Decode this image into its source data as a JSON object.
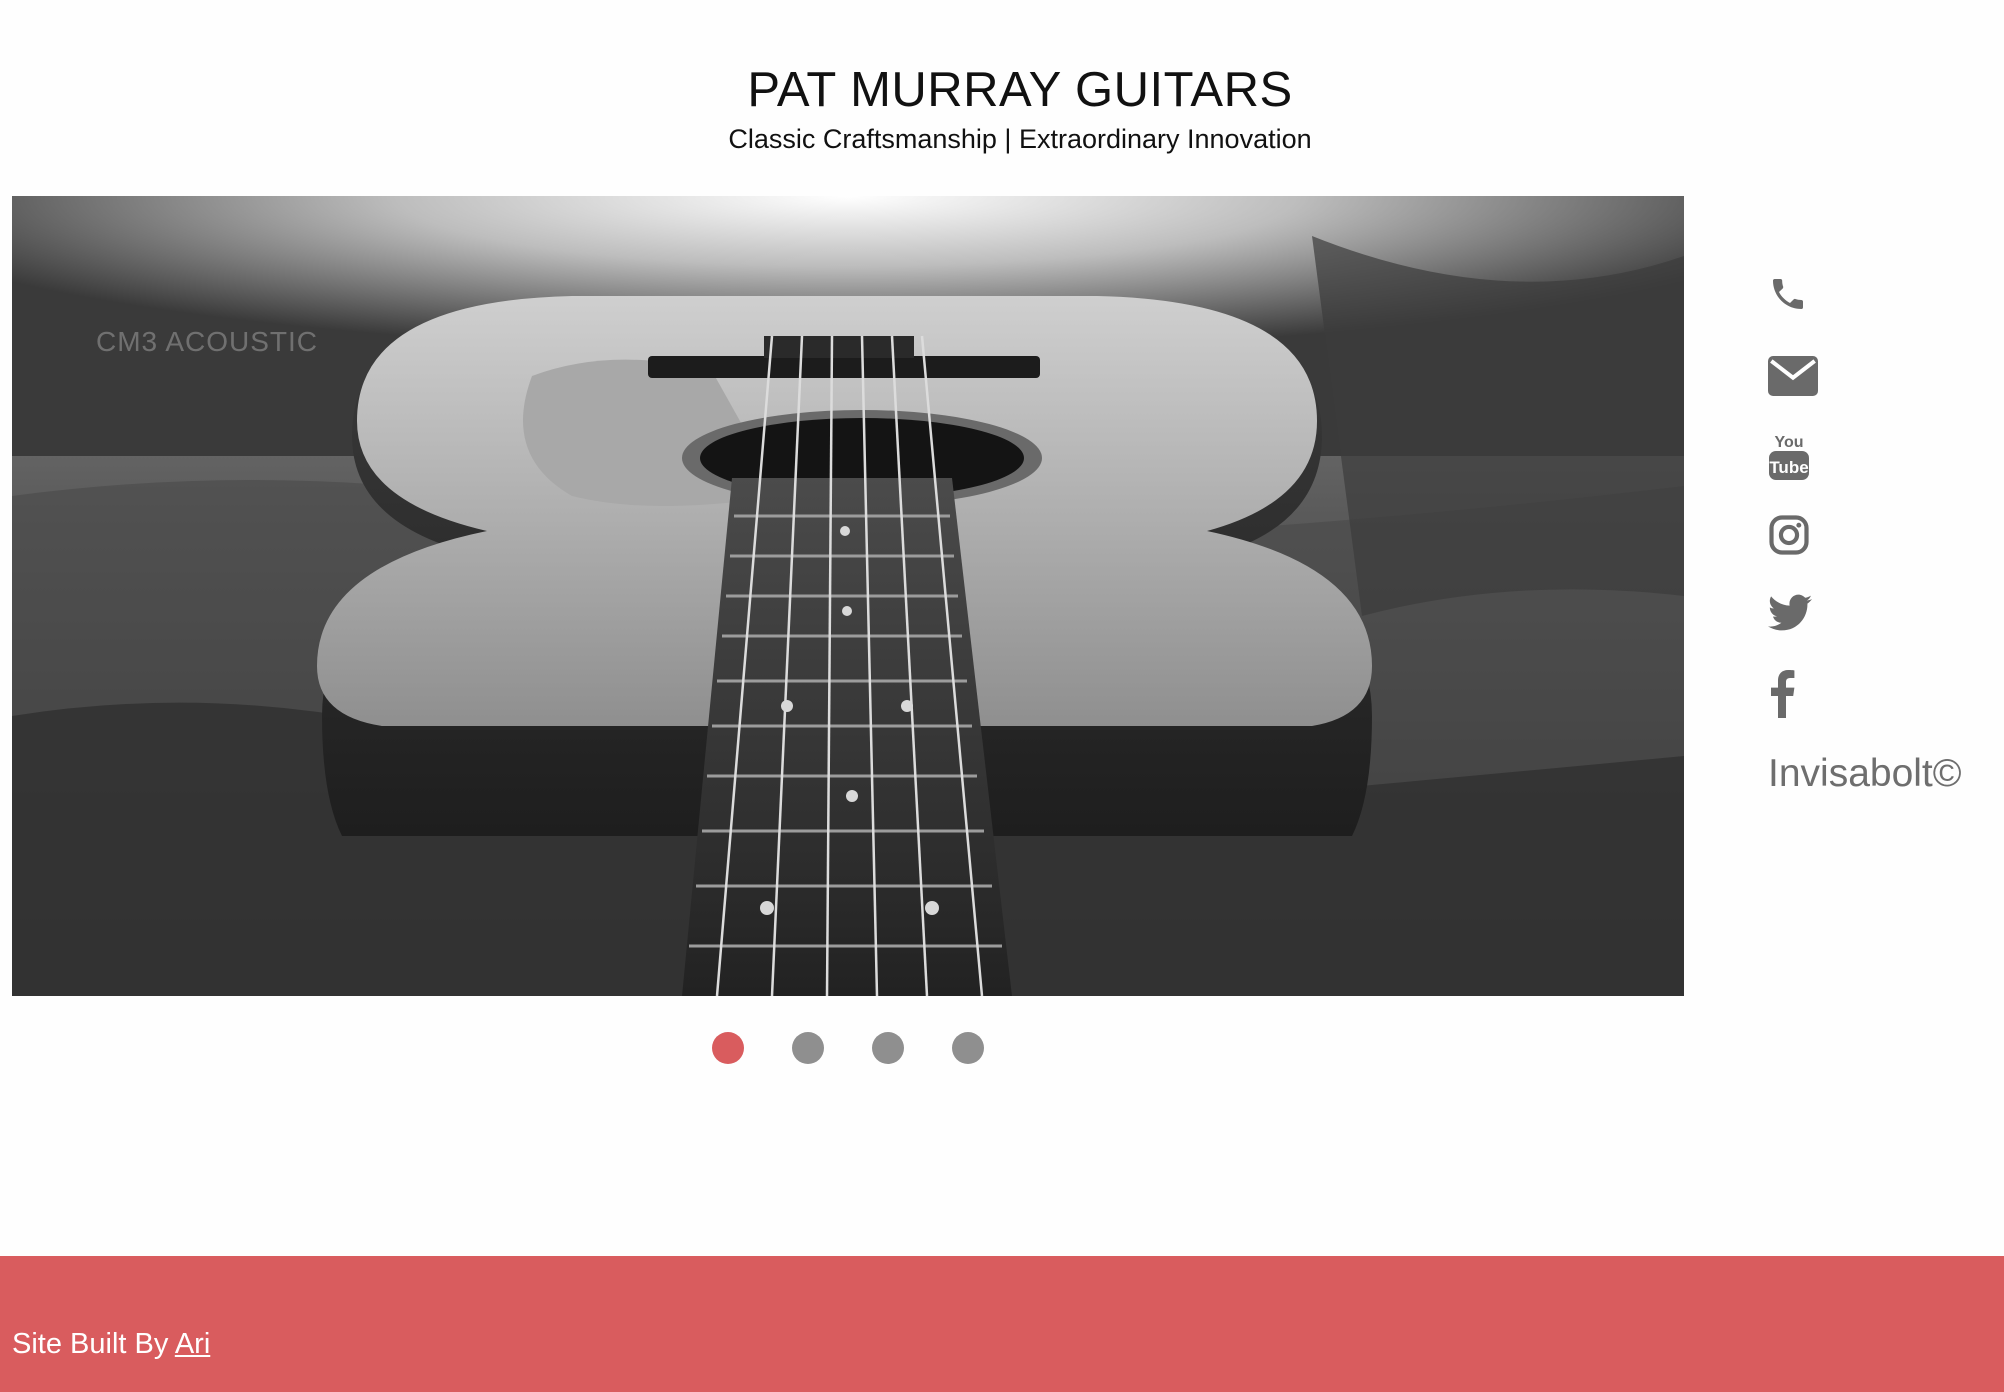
{
  "header": {
    "title": "PAT MURRAY GUITARS",
    "tagline": "Classic Craftsmanship | Extraordinary Innovation"
  },
  "slider": {
    "caption": "CM3 ACOUSTIC",
    "active_slide": 1,
    "slide_count": 4
  },
  "social": {
    "icons": [
      "phone-icon",
      "email-icon",
      "youtube-icon",
      "instagram-icon",
      "twitter-icon",
      "facebook-icon"
    ],
    "youtube_you": "You",
    "youtube_tube": "Tube",
    "brand": "Invisabolt©"
  },
  "footer": {
    "credit_prefix": "Site Built By ",
    "credit_link": "Ari"
  },
  "colors": {
    "accent": "#d95c5e",
    "icon": "#6a6a6a",
    "dot_inactive": "#8f8f8f"
  }
}
